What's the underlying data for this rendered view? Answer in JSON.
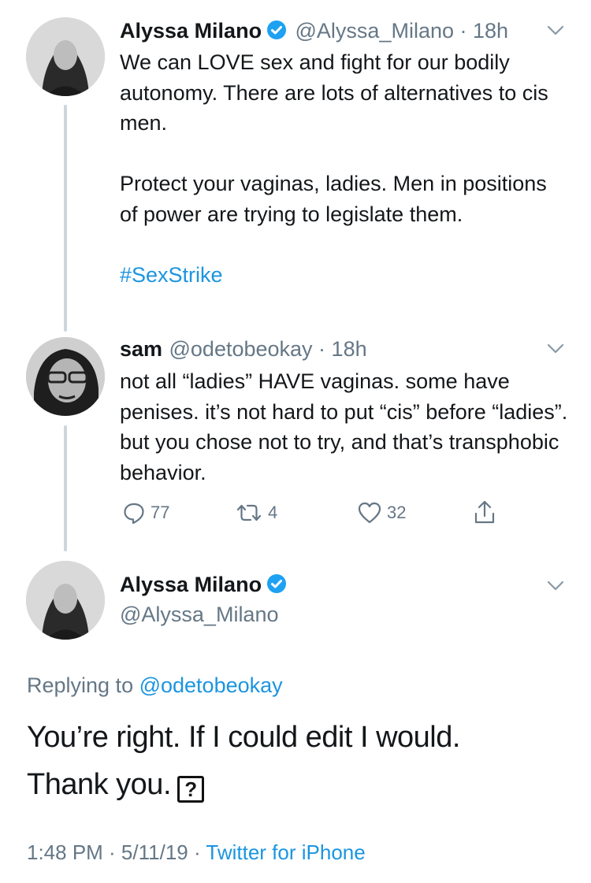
{
  "tweet1": {
    "name": "Alyssa Milano",
    "handle": "@Alyssa_Milano",
    "time": "18h",
    "paragraphs": [
      "We can LOVE sex and fight for our bodily autonomy. There are lots of alternatives to cis men.",
      "Protect your vaginas, ladies. Men in positions of power are trying to legislate them."
    ],
    "hashtag": "#SexStrike",
    "avatar_icon": "profile-photo"
  },
  "tweet2": {
    "name": "sam",
    "handle": "@odetobeokay",
    "time": "18h",
    "text": "not all “ladies” HAVE vaginas. some have penises. it’s not hard to put “cis” before “ladies”. but you chose not to try, and that’s transphobic behavior.",
    "actions": {
      "reply_count": "77",
      "retweet_count": "4",
      "like_count": "32"
    },
    "avatar_icon": "profile-photo"
  },
  "tweet3": {
    "name": "Alyssa Milano",
    "handle": "@Alyssa_Milano",
    "replying_prefix": "Replying to ",
    "replying_to": "@odetobeokay",
    "line1": "You’re right. If I could edit I would.",
    "line2": "Thank you.",
    "emoji_placeholder": "?",
    "timestamp": "1:48 PM · 5/11/19 · ",
    "source": "Twitter for iPhone"
  },
  "colors": {
    "text": "#14171a",
    "secondary": "#657786",
    "link": "#1b95e0",
    "verified": "#1da1f2",
    "thread_line": "#ccd6dd"
  }
}
